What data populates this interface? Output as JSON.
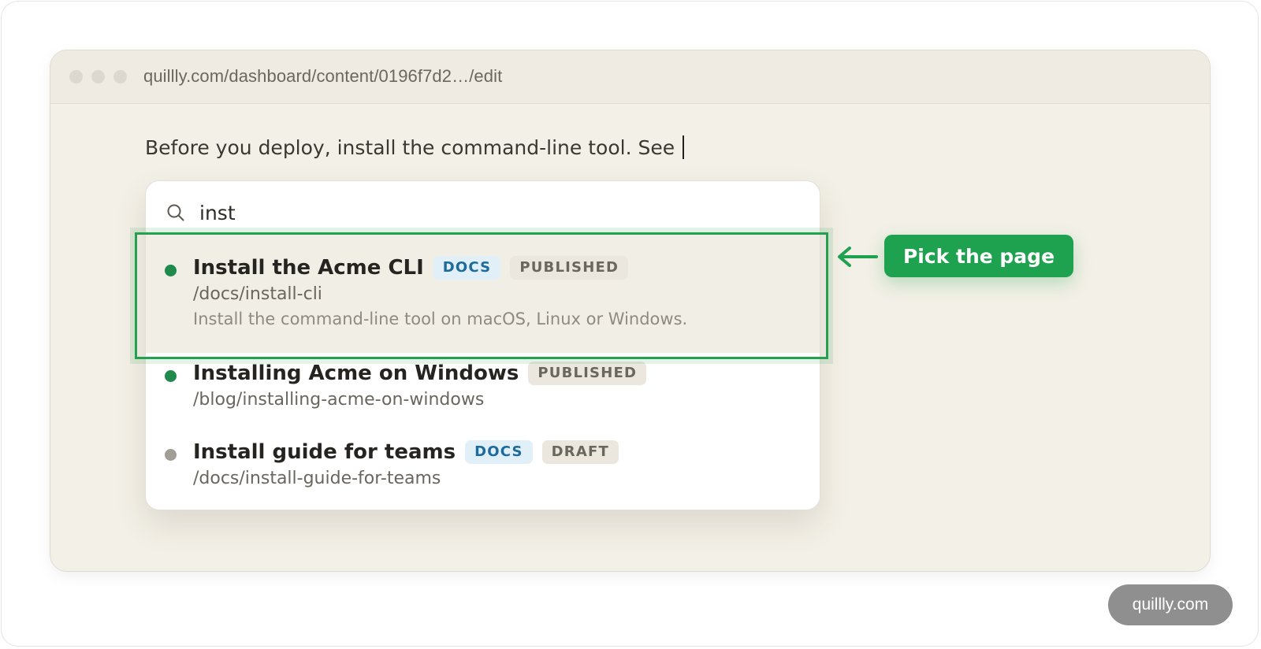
{
  "browser": {
    "url": "quillly.com/dashboard/content/0196f7d2…/edit"
  },
  "editor": {
    "text": "Before you deploy, install the command-line tool. See"
  },
  "search": {
    "query": "inst",
    "icon": "search-icon"
  },
  "results": [
    {
      "title": "Install the Acme CLI",
      "type_badge": "DOCS",
      "status_badge": "PUBLISHED",
      "path": "/docs/install-cli",
      "description": "Install the command-line tool on macOS, Linux or Windows.",
      "status_color": "#1f8a4c",
      "highlighted": true
    },
    {
      "title": "Installing Acme on Windows",
      "status_badge": "PUBLISHED",
      "path": "/blog/installing-acme-on-windows",
      "status_color": "#1f8a4c"
    },
    {
      "title": "Install guide for teams",
      "type_badge": "DOCS",
      "status_badge": "DRAFT",
      "path": "/docs/install-guide-for-teams",
      "status_color": "#a29e96"
    }
  ],
  "annotation": {
    "callout_label": "Pick the page",
    "accent_color": "#1fa24f"
  },
  "watermark": {
    "label": "quillly.com"
  }
}
